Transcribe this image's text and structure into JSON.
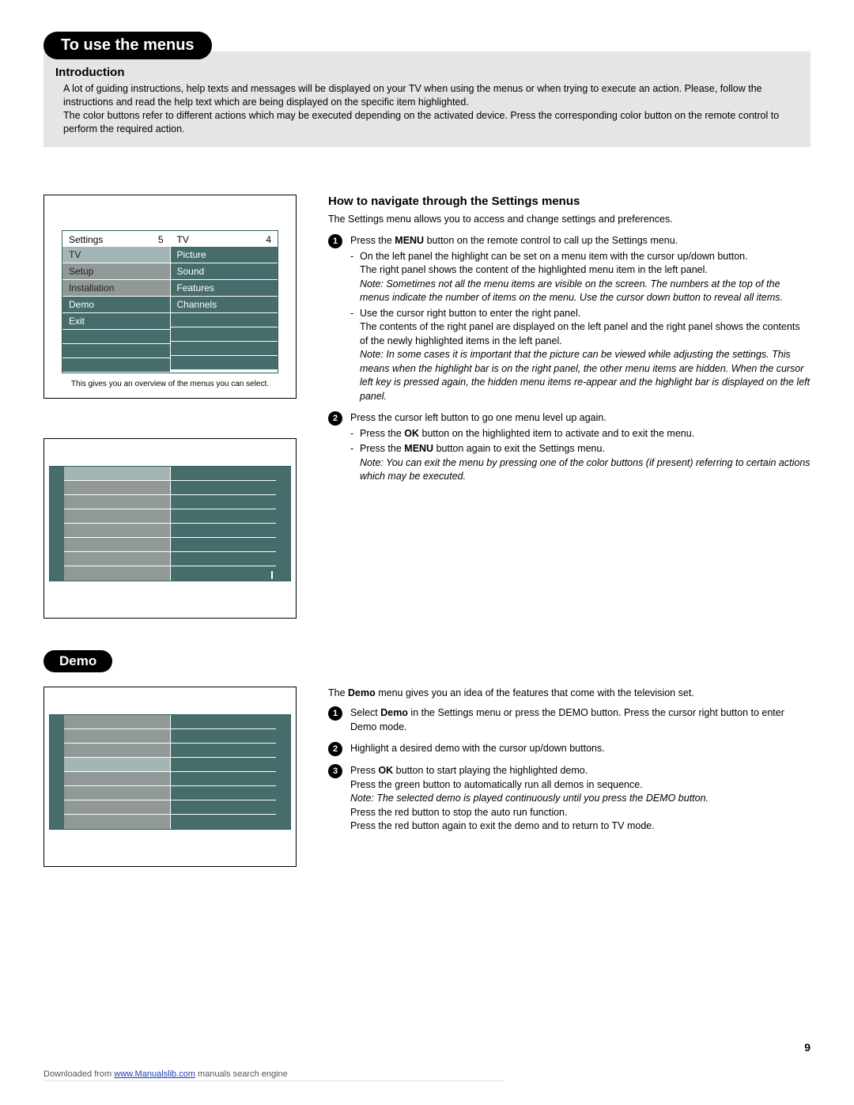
{
  "pill_main": "To use the menus",
  "intro_heading": "Introduction",
  "intro_p1": "A lot of guiding instructions, help texts and messages will be displayed on your TV when using the menus or when trying to execute an action. Please, follow the instructions and read the help text which are being displayed on the specific item highlighted.",
  "intro_p2": "The color buttons refer to different actions which may be executed depending on the activated device. Press the corresponding color button on the remote control to perform the required action.",
  "menu1": {
    "left_header": "Settings",
    "left_num": "5",
    "right_header": "TV",
    "right_num": "4",
    "left_items": [
      "TV",
      "Setup",
      "Installation",
      "Demo",
      "Exit"
    ],
    "right_items": [
      "Picture",
      "Sound",
      "Features",
      "Channels"
    ],
    "caption": "This gives you an overview of the menus you can select."
  },
  "nav_heading": "How to navigate through the Settings menus",
  "nav_intro": "The Settings menu allows you to access and change settings and preferences.",
  "step1_a": "Press the ",
  "step1_b": "MENU",
  "step1_c": " button on the remote control to call up the Settings menu.",
  "step1_sub1": "On the left panel the highlight can be set on a menu item with the cursor up/down button.",
  "step1_sub1b": "The right panel shows the content of the highlighted menu item in the left panel.",
  "step1_note1": "Note: Sometimes not all the menu items are visible on the screen. The numbers at the top of the menus indicate the number of items on the menu.  Use the cursor down button to reveal all items.",
  "step1_sub2": "Use the cursor right button to enter the right panel.",
  "step1_sub2b": "The contents of the right panel are displayed on the left panel and the right panel shows the contents of the newly highlighted items in the left panel.",
  "step1_note2": "Note: In some cases it is important that the picture can be viewed while adjusting the settings. This means when the highlight bar is on the right panel, the other menu items are hidden. When the cursor left key is pressed again, the hidden menu items re-appear and the highlight bar is displayed on the left panel.",
  "step2_a": "Press the cursor left button to go one menu level up again.",
  "step2_sub1a": "Press the ",
  "step2_sub1b": "OK",
  "step2_sub1c": " button on the highlighted item to activate and to exit the menu.",
  "step2_sub2a": "Press the ",
  "step2_sub2b": "MENU",
  "step2_sub2c": " button again to exit the Settings menu.",
  "step2_note": "Note: You can exit the menu by pressing one of the color buttons (if present) referring to certain actions which may be executed.",
  "pill_demo": "Demo",
  "demo_intro_a": "The ",
  "demo_intro_b": "Demo",
  "demo_intro_c": " menu gives you an idea of the features that come with the television set.",
  "demo_step1_a": "Select ",
  "demo_step1_b": "Demo",
  "demo_step1_c": " in the Settings menu or press the DEMO button.  Press the cursor right button to enter Demo mode.",
  "demo_step2": "Highlight a desired demo with the cursor up/down buttons.",
  "demo_step3_a": "Press ",
  "demo_step3_b": "OK",
  "demo_step3_c": " button to start playing the highlighted demo.",
  "demo_step3_l2": "Press the green button to automatically run all demos in sequence.",
  "demo_step3_note": "Note: The selected demo is played continuously until you press the DEMO button.",
  "demo_step3_l3": "Press the red button to stop the auto run function.",
  "demo_step3_l4": "Press the red button again to exit the demo and to return to TV mode.",
  "page_number": "9",
  "footer_pre": "Downloaded from ",
  "footer_link": "www.Manualslib.com",
  "footer_post": " manuals search engine"
}
